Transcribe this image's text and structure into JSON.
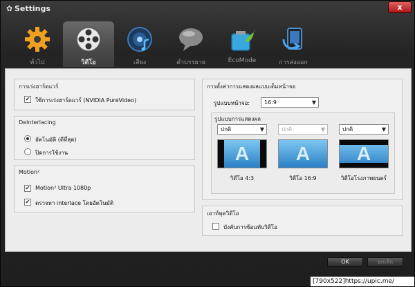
{
  "window": {
    "title": "Settings",
    "close_label": "x"
  },
  "tabs": [
    {
      "label": "ทั่วไป",
      "icon": "gear-icon"
    },
    {
      "label": "วิดีโอ",
      "icon": "film-reel-icon",
      "active": true
    },
    {
      "label": "เสียง",
      "icon": "speaker-icon"
    },
    {
      "label": "คำบรรยาย",
      "icon": "speech-bubble-icon"
    },
    {
      "label": "EcoMode",
      "icon": "battery-leaf-icon"
    },
    {
      "label": "การส่งออก",
      "icon": "export-icon"
    }
  ],
  "hw_accel": {
    "title": "การเร่งฮาร์ดแวร์",
    "option_label": "ใช้การเร่งฮาร์ดแวร์ (NVIDIA PureVideo)",
    "checked": true
  },
  "deinterlacing": {
    "title": "Deinterlacing",
    "options": [
      {
        "label": "อัตโนมัติ (ดีที่สุด)",
        "selected": true
      },
      {
        "label": "ปิดการใช้งาน",
        "selected": false
      }
    ]
  },
  "motion": {
    "title": "Motion²",
    "options": [
      {
        "label": "Motion² Ultra 1080p",
        "checked": true
      },
      {
        "label": "ตรวจหา interlace โดยอัตโนมัติ",
        "checked": true
      }
    ]
  },
  "fullscreen": {
    "title": "การตั้งค่าการแสดงผลแบบเต็มหน้าจอ",
    "aspect_label": "รูปแบบหน้าจอ:",
    "aspect_value": "16:9",
    "display_mode_title": "รูปแบบการแสดงผล",
    "modes": [
      {
        "select_value": "ปกติ",
        "enabled": true,
        "caption": "วิดีโอ 4:3"
      },
      {
        "select_value": "ปกติ",
        "enabled": false,
        "caption": "วิดีโอ 16:9"
      },
      {
        "select_value": "ปกติ",
        "enabled": true,
        "caption": "วิดีโอโรงภาพยนตร์"
      }
    ],
    "preview_letter": "A"
  },
  "video_output": {
    "title": "เอาท์พุตวิดีโอ",
    "option_label": "บังคับการซ้อนทับวิดีโอ",
    "checked": false
  },
  "footer": {
    "ok_label": "OK",
    "cancel_label": "ยกเลิก"
  },
  "watermark": "[790x522]https://upic.me/",
  "colors": {
    "accent_blue": "#2c7fc5",
    "active_tab": "#5a5a5a",
    "close_red": "#c02020"
  }
}
